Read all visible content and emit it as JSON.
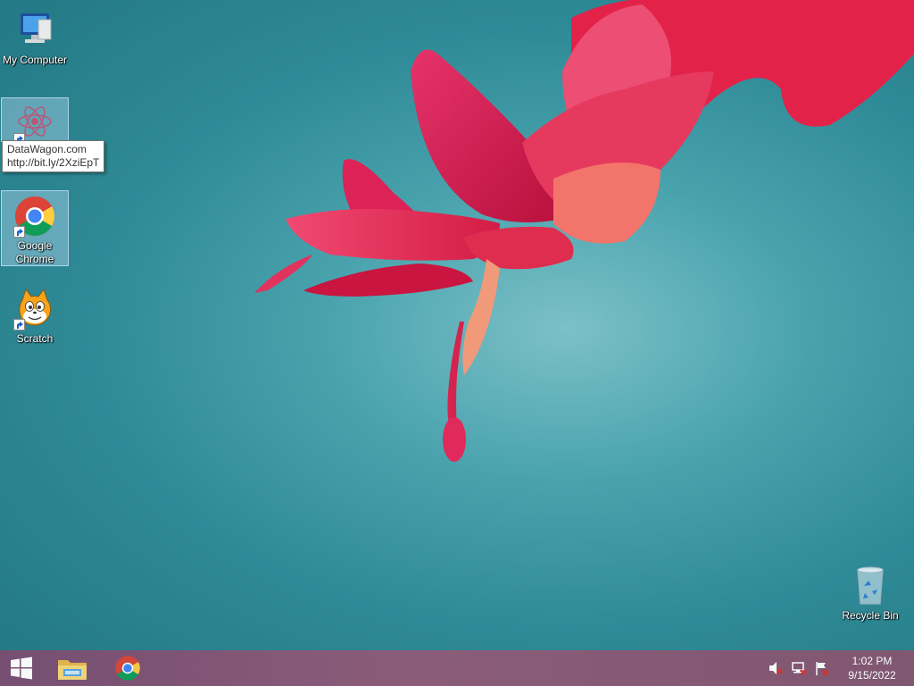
{
  "desktop": {
    "icons": [
      {
        "label": "My Computer"
      },
      {
        "label": ""
      },
      {
        "label": "Google Chrome"
      },
      {
        "label": "Scratch"
      },
      {
        "label": "Recycle Bin"
      }
    ],
    "tooltip": {
      "line1": "DataWagon.com",
      "line2": "http://bit.ly/2XziEpT"
    }
  },
  "taskbar": {
    "start_icon": "windows-logo-icon",
    "pinned": [
      "file-explorer-icon",
      "chrome-icon"
    ],
    "tray": [
      "volume-muted-icon",
      "network-icon",
      "action-center-flag-icon"
    ],
    "clock": {
      "time": "1:02 PM",
      "date": "9/15/2022"
    }
  },
  "colors": {
    "accent_taskbar": "#8a5876",
    "selection": "#aad2eb"
  }
}
